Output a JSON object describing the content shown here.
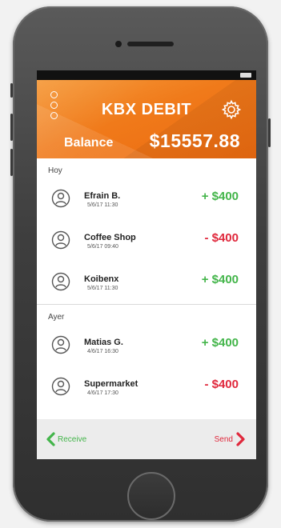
{
  "app": {
    "title": "KBX DEBIT",
    "balance_label": "Balance",
    "balance_value": "$15557.88"
  },
  "sections": [
    {
      "label": "Hoy",
      "transactions": [
        {
          "name": "Efrain B.",
          "date": "5/6/17 11:30",
          "amount": "+ $400",
          "type": "positive"
        },
        {
          "name": "Coffee Shop",
          "date": "5/6/17 09:40",
          "amount": "- $400",
          "type": "negative"
        },
        {
          "name": "Koibenx",
          "date": "5/6/17 11:30",
          "amount": "+ $400",
          "type": "positive"
        }
      ]
    },
    {
      "label": "Ayer",
      "transactions": [
        {
          "name": "Matias G.",
          "date": "4/6/17 16:30",
          "amount": "+ $400",
          "type": "positive"
        },
        {
          "name": "Supermarket",
          "date": "4/6/17 17:30",
          "amount": "- $400",
          "type": "negative"
        }
      ]
    }
  ],
  "footer": {
    "receive_label": "Receive",
    "send_label": "Send"
  },
  "colors": {
    "accent": "#f07a1a",
    "positive": "#43b54a",
    "negative": "#e0283c"
  },
  "icons": {
    "menu": "menu-icon",
    "settings": "gear-icon",
    "avatar": "user-icon",
    "receive": "chevron-left-icon",
    "send": "chevron-right-icon"
  }
}
